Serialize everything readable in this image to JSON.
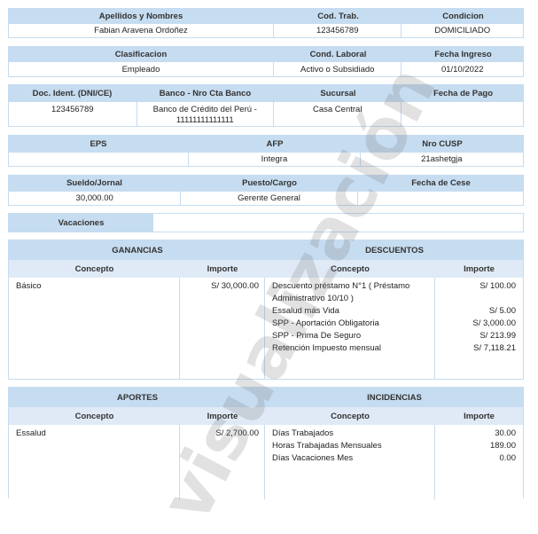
{
  "employee": {
    "labels": {
      "name": "Apellidos y Nombres",
      "code": "Cod. Trab.",
      "condition": "Condicion"
    },
    "values": {
      "name": "Fabian Aravena Ordoñez",
      "code": "123456789",
      "condition": "DOMICILIADO"
    }
  },
  "classification": {
    "labels": {
      "classification": "Clasificacion",
      "labor_condition": "Cond. Laboral",
      "entry_date": "Fecha Ingreso"
    },
    "values": {
      "classification": "Empleado",
      "labor_condition": "Activo o Subsidiado",
      "entry_date": "01/10/2022"
    }
  },
  "bank": {
    "labels": {
      "id_doc": "Doc. Ident. (DNI/CE)",
      "bank": "Banco - Nro Cta Banco",
      "branch": "Sucursal",
      "pay_date": "Fecha de Pago"
    },
    "values": {
      "id_doc": "123456789",
      "bank": "Banco de Crédito del Perú - 11111111111111",
      "branch": "Casa Central",
      "pay_date": ""
    }
  },
  "pension": {
    "labels": {
      "eps": "EPS",
      "afp": "AFP",
      "cusp": "Nro CUSP"
    },
    "values": {
      "eps": "",
      "afp": "Integra",
      "cusp": "21ashetgja"
    }
  },
  "salary": {
    "labels": {
      "salary": "Sueldo/Jornal",
      "position": "Puesto/Cargo",
      "end_date": "Fecha de Cese"
    },
    "values": {
      "salary": "30,000.00",
      "position": "Gerente General",
      "end_date": ""
    }
  },
  "vacations": {
    "label": "Vacaciones",
    "value": ""
  },
  "earnings_section": {
    "left_title": "GANANCIAS",
    "right_title": "DESCUENTOS",
    "concept_label": "Concepto",
    "amount_label": "Importe",
    "earnings": [
      {
        "concept": "Básico",
        "amount": "S/ 30,000.00"
      }
    ],
    "discounts": [
      {
        "concept": "Descuento préstamo N°1 ( Préstamo",
        "amount": "S/ 100.00"
      },
      {
        "concept": "Administrativo 10/10 )",
        "amount": ""
      },
      {
        "concept": "Essalud más Vida",
        "amount": "S/ 5.00"
      },
      {
        "concept": "SPP - Aportación Obligatoria",
        "amount": "S/ 3,000.00"
      },
      {
        "concept": "SPP - Prima De Seguro",
        "amount": "S/ 213.99"
      },
      {
        "concept": "Retención Impuesto mensual",
        "amount": "S/ 7,118.21"
      }
    ]
  },
  "contributions_section": {
    "left_title": "APORTES",
    "right_title": "INCIDENCIAS",
    "concept_label": "Concepto",
    "amount_label": "Importe",
    "contributions": [
      {
        "concept": "Essalud",
        "amount": "S/ 2,700.00"
      }
    ],
    "incidences": [
      {
        "concept": "Días Trabajados",
        "amount": "30.00"
      },
      {
        "concept": "Horas Trabajadas Mensuales",
        "amount": "189.00"
      },
      {
        "concept": "Días Vacaciones Mes",
        "amount": "0.00"
      }
    ]
  },
  "watermark": "visualización"
}
